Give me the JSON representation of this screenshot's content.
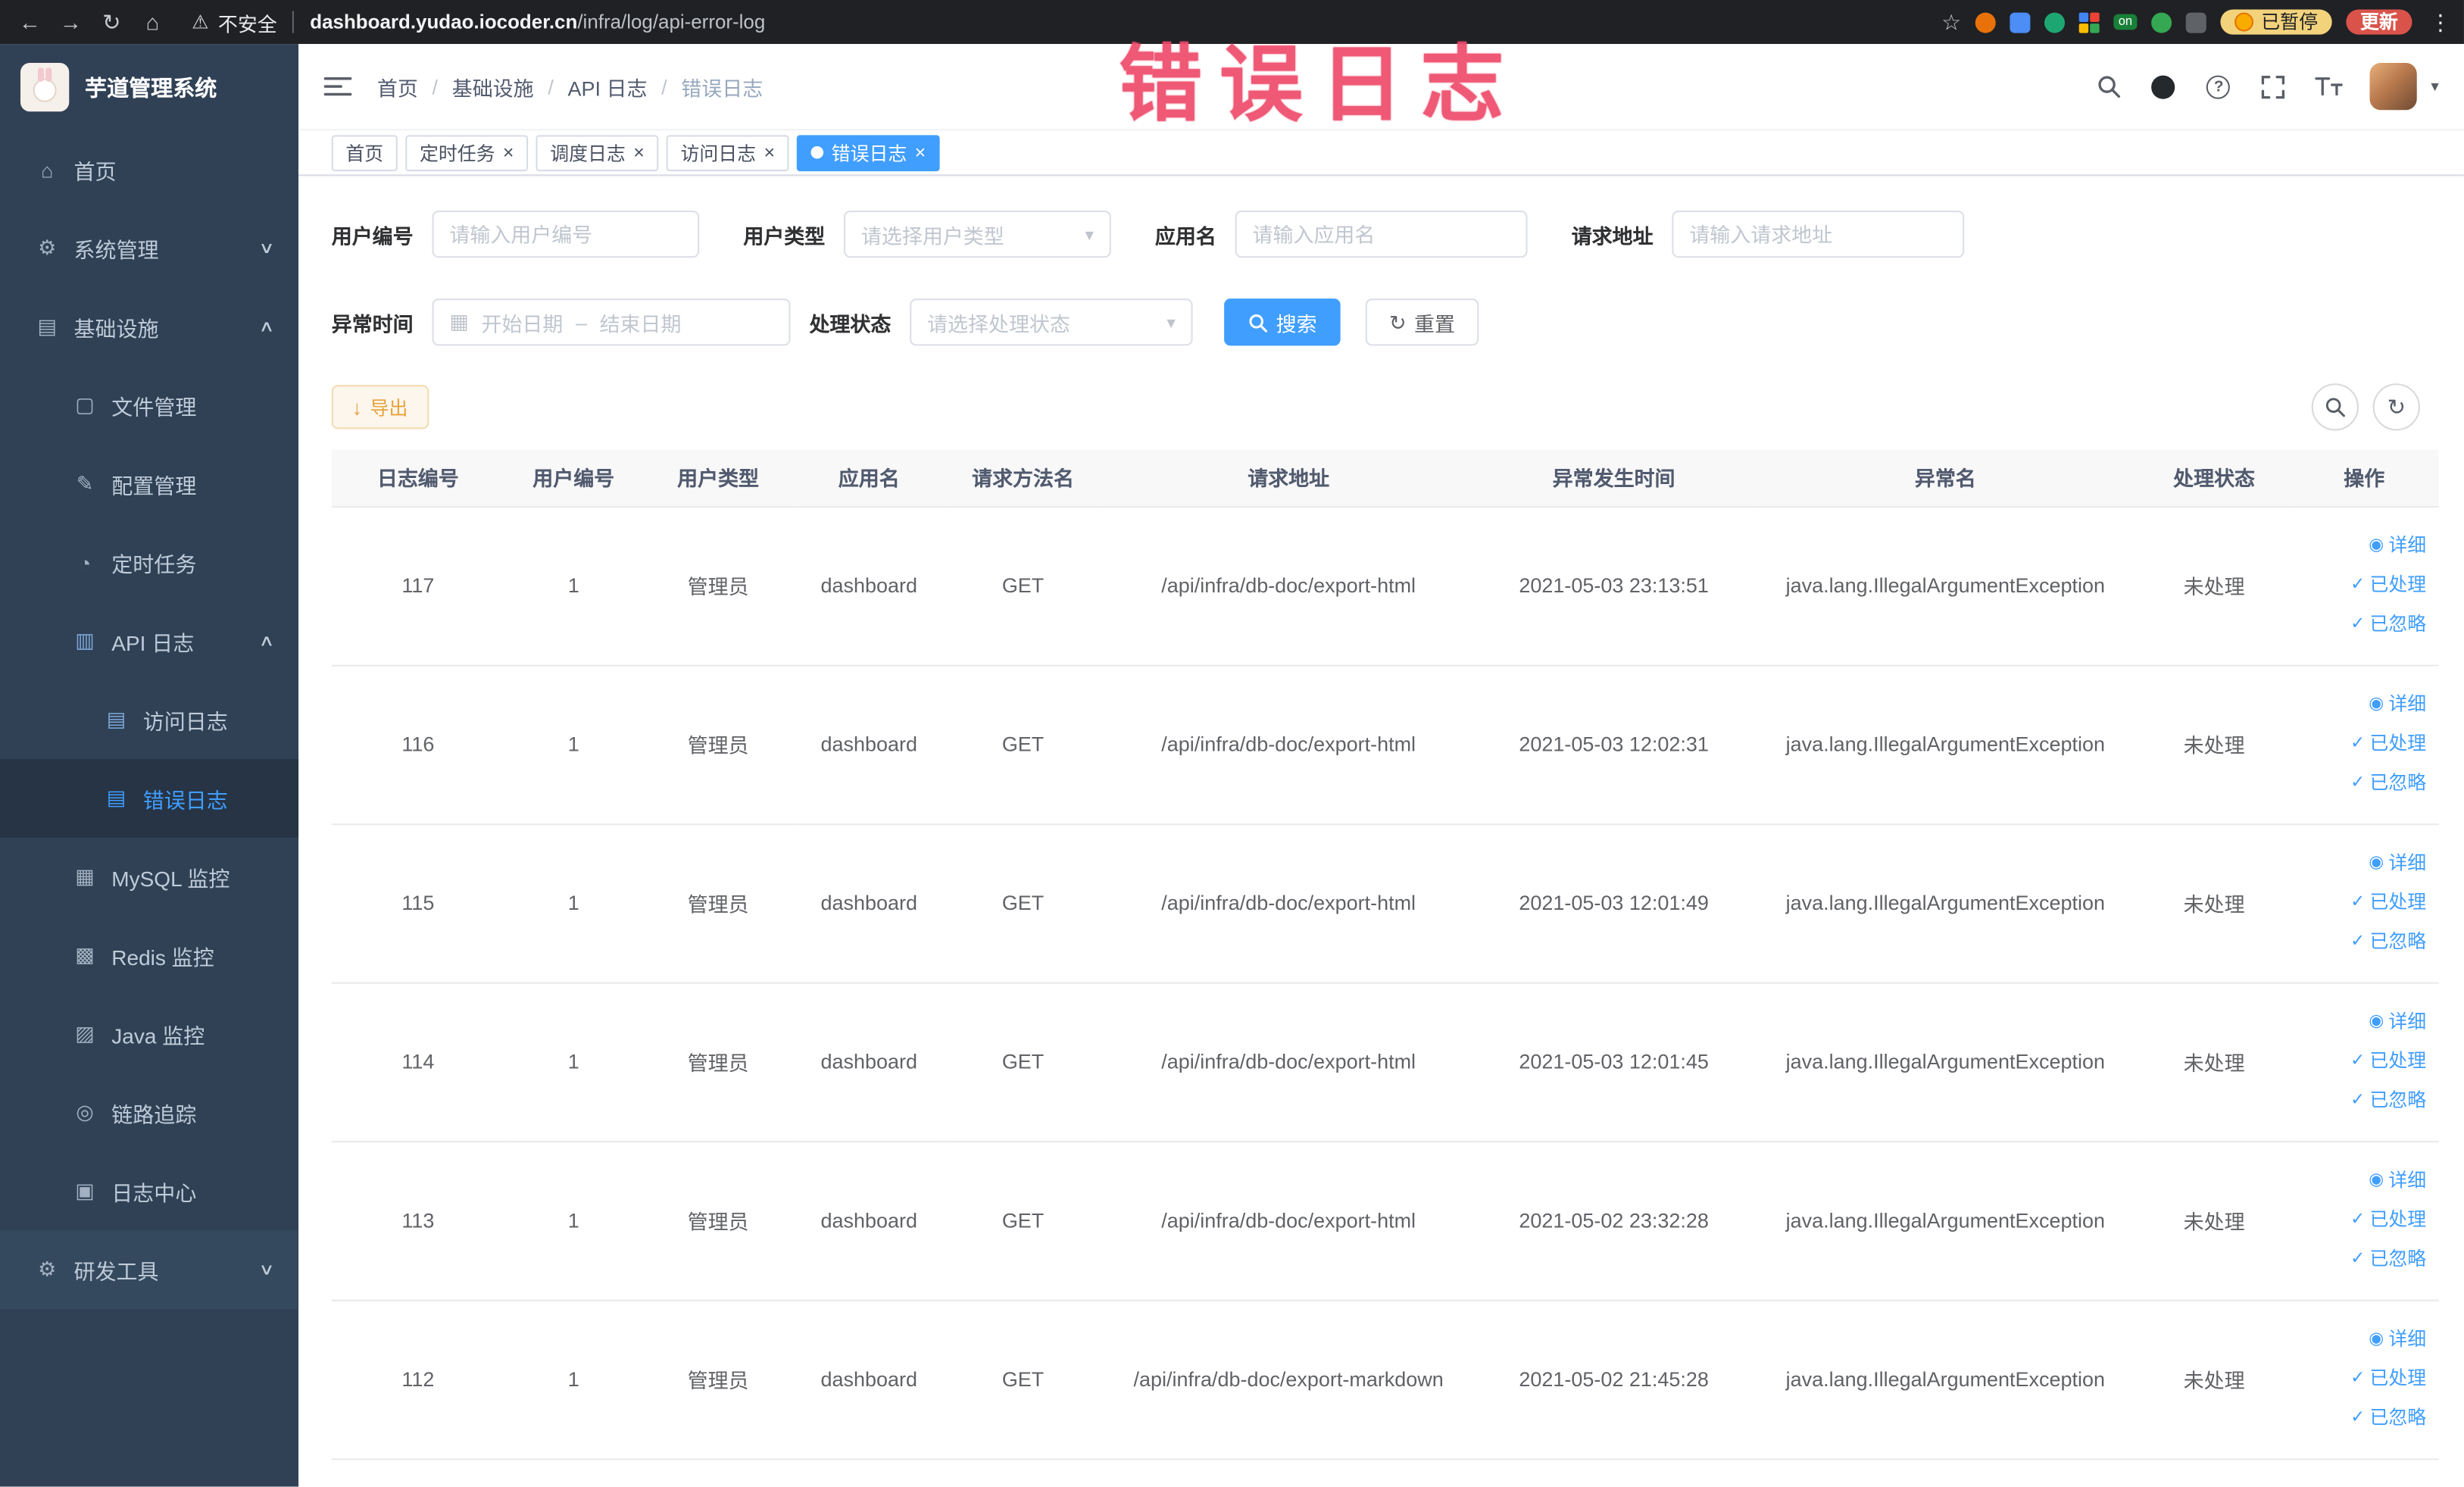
{
  "browser": {
    "security_label": "不安全",
    "url_host": "dashboard.yudao.iocoder.cn",
    "url_path": "/infra/log/api-error-log",
    "extension_on_badge": "on",
    "paused_badge": "已暂停",
    "update_label": "更新"
  },
  "annotation_text": "错误日志",
  "icons": {
    "back": "←",
    "forward": "→",
    "reload": "↻",
    "home": "⌂",
    "warning": "⚠",
    "star": "☆",
    "kebab": "⋮",
    "close": "×",
    "caret_down": "▾",
    "calendar": "▦",
    "eye": "◉",
    "check": "✓",
    "download": "↓",
    "refresh": "↻"
  },
  "sidebar": {
    "logo_title": "芋道管理系统",
    "items": [
      {
        "label": "首页",
        "icon": "⌂"
      },
      {
        "label": "系统管理",
        "icon": "⚙",
        "chevron": "∨"
      },
      {
        "label": "基础设施",
        "icon": "▤",
        "chevron": "∧"
      },
      {
        "label": "文件管理",
        "icon": "▢"
      },
      {
        "label": "配置管理",
        "icon": "✎"
      },
      {
        "label": "定时任务",
        "icon": "◔"
      },
      {
        "label": "API 日志",
        "icon": "▥",
        "chevron": "∧"
      },
      {
        "label": "访问日志",
        "icon": "▤"
      },
      {
        "label": "错误日志",
        "icon": "▤"
      },
      {
        "label": "MySQL 监控",
        "icon": "▦"
      },
      {
        "label": "Redis 监控",
        "icon": "▩"
      },
      {
        "label": "Java 监控",
        "icon": "▨"
      },
      {
        "label": "链路追踪",
        "icon": "◎"
      },
      {
        "label": "日志中心",
        "icon": "▣"
      },
      {
        "label": "研发工具",
        "icon": "⚙",
        "chevron": "∨"
      }
    ]
  },
  "breadcrumb": {
    "items": [
      "首页",
      "基础设施",
      "API 日志",
      "错误日志"
    ]
  },
  "tabs": [
    {
      "label": "首页"
    },
    {
      "label": "定时任务"
    },
    {
      "label": "调度日志"
    },
    {
      "label": "访问日志"
    },
    {
      "label": "错误日志"
    }
  ],
  "filters": {
    "user_id_label": "用户编号",
    "user_id_placeholder": "请输入用户编号",
    "user_type_label": "用户类型",
    "user_type_placeholder": "请选择用户类型",
    "app_name_label": "应用名",
    "app_name_placeholder": "请输入应用名",
    "request_url_label": "请求地址",
    "request_url_placeholder": "请输入请求地址",
    "exception_time_label": "异常时间",
    "start_placeholder": "开始日期",
    "range_separator": "–",
    "end_placeholder": "结束日期",
    "process_status_label": "处理状态",
    "process_status_placeholder": "请选择处理状态",
    "search_label": "搜索",
    "reset_label": "重置"
  },
  "toolbar": {
    "export_label": "导出"
  },
  "table": {
    "columns": [
      "日志编号",
      "用户编号",
      "用户类型",
      "应用名",
      "请求方法名",
      "请求地址",
      "异常发生时间",
      "异常名",
      "处理状态",
      "操作"
    ],
    "actions": {
      "detail": "详细",
      "processed": "已处理",
      "ignored": "已忽略"
    },
    "rows": [
      {
        "id": "117",
        "user_id": "1",
        "user_type": "管理员",
        "app": "dashboard",
        "method": "GET",
        "url": "/api/infra/db-doc/export-html",
        "time": "2021-05-03 23:13:51",
        "exception": "java.lang.IllegalArgumentException",
        "status": "未处理"
      },
      {
        "id": "116",
        "user_id": "1",
        "user_type": "管理员",
        "app": "dashboard",
        "method": "GET",
        "url": "/api/infra/db-doc/export-html",
        "time": "2021-05-03 12:02:31",
        "exception": "java.lang.IllegalArgumentException",
        "status": "未处理"
      },
      {
        "id": "115",
        "user_id": "1",
        "user_type": "管理员",
        "app": "dashboard",
        "method": "GET",
        "url": "/api/infra/db-doc/export-html",
        "time": "2021-05-03 12:01:49",
        "exception": "java.lang.IllegalArgumentException",
        "status": "未处理"
      },
      {
        "id": "114",
        "user_id": "1",
        "user_type": "管理员",
        "app": "dashboard",
        "method": "GET",
        "url": "/api/infra/db-doc/export-html",
        "time": "2021-05-03 12:01:45",
        "exception": "java.lang.IllegalArgumentException",
        "status": "未处理"
      },
      {
        "id": "113",
        "user_id": "1",
        "user_type": "管理员",
        "app": "dashboard",
        "method": "GET",
        "url": "/api/infra/db-doc/export-html",
        "time": "2021-05-02 23:32:28",
        "exception": "java.lang.IllegalArgumentException",
        "status": "未处理"
      },
      {
        "id": "112",
        "user_id": "1",
        "user_type": "管理员",
        "app": "dashboard",
        "method": "GET",
        "url": "/api/infra/db-doc/export-markdown",
        "time": "2021-05-02 21:45:28",
        "exception": "java.lang.IllegalArgumentException",
        "status": "未处理"
      }
    ]
  }
}
